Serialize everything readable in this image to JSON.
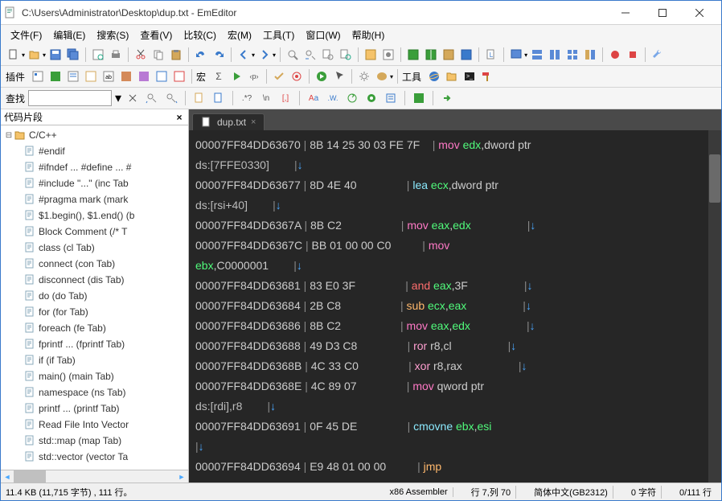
{
  "window": {
    "title": "C:\\Users\\Administrator\\Desktop\\dup.txt - EmEditor"
  },
  "menu": {
    "file": "文件(F)",
    "edit": "编辑(E)",
    "search": "搜索(S)",
    "view": "查看(V)",
    "compare": "比较(C)",
    "macro": "宏(M)",
    "tools": "工具(T)",
    "window": "窗口(W)",
    "help": "帮助(H)"
  },
  "toolbar2": {
    "plugins_label": "插件",
    "macro_label": "宏",
    "tools_label": "工具"
  },
  "findbar": {
    "label": "查找",
    "value": ""
  },
  "sidebar": {
    "title": "代码片段",
    "root": "C/C++",
    "items": [
      "#endif",
      "#ifndef ... #define ... #",
      "#include \"...\"  (inc Tab",
      "#pragma mark  (mark",
      "$1.begin(), $1.end()  (b",
      "Block Comment  (/* T",
      "class  (cl Tab)",
      "connect  (con Tab)",
      "disconnect  (dis Tab)",
      "do  (do Tab)",
      "for  (for Tab)",
      "foreach  (fe Tab)",
      "fprintf ...  (fprintf Tab)",
      "if  (if Tab)",
      "main()  (main Tab)",
      "namespace  (ns Tab)",
      "printf ...  (printf Tab)",
      "Read File Into Vector",
      "std::map  (map Tab)",
      "std::vector  (vector Ta"
    ]
  },
  "tabs": {
    "active": "dup.txt"
  },
  "code": {
    "lines": [
      {
        "addr": "00007FF84DD63670",
        "hex": "8B 14 25 30 03 FE 7F",
        "op": "mov",
        "args": [
          "edx",
          ",dword ptr"
        ]
      },
      {
        "cont": "ds:[7FFE0330]",
        "arrow": "↓"
      },
      {
        "addr": "00007FF84DD63677",
        "hex": "8D 4E 40",
        "op": "lea",
        "args": [
          "ecx",
          ",dword ptr"
        ]
      },
      {
        "cont": "ds:[rsi+40]",
        "arrow": "↓"
      },
      {
        "addr": "00007FF84DD6367A",
        "hex": "8B C2",
        "op": "mov",
        "args": [
          "eax",
          ",",
          "edx"
        ],
        "tail": "↓"
      },
      {
        "addr": "00007FF84DD6367C",
        "hex": "BB 01 00 00 C0",
        "op": "mov",
        "args": []
      },
      {
        "cont": "ebx,C0000001",
        "isreg": true,
        "arrow": "↓"
      },
      {
        "addr": "00007FF84DD63681",
        "hex": "83 E0 3F",
        "op": "and",
        "args": [
          "eax",
          ",3F"
        ],
        "tail": "↓"
      },
      {
        "addr": "00007FF84DD63684",
        "hex": "2B C8",
        "op": "sub",
        "args": [
          "ecx",
          ",",
          "eax"
        ],
        "tail": "↓"
      },
      {
        "addr": "00007FF84DD63686",
        "hex": "8B C2",
        "op": "mov",
        "args": [
          "eax",
          ",",
          "edx"
        ],
        "tail": "↓"
      },
      {
        "addr": "00007FF84DD63688",
        "hex": "49 D3 C8",
        "op": "ror",
        "args": [
          " r8,cl"
        ],
        "tail": "↓"
      },
      {
        "addr": "00007FF84DD6368B",
        "hex": "4C 33 C0",
        "op": "xor",
        "args": [
          " r8,rax"
        ],
        "tail": "↓"
      },
      {
        "addr": "00007FF84DD6368E",
        "hex": "4C 89 07",
        "op": "mov",
        "args": [
          " qword ptr"
        ]
      },
      {
        "cont": "ds:[rdi],r8",
        "arrow": "↓"
      },
      {
        "addr": "00007FF84DD63691",
        "hex": "0F 45 DE",
        "op": "cmovne",
        "args": [
          "ebx",
          ",",
          "esi"
        ]
      },
      {
        "arrow_only": "↓"
      },
      {
        "addr": "00007FF84DD63694",
        "hex": "E9 48 01 00 00",
        "op": "jmp",
        "args": []
      }
    ]
  },
  "status": {
    "left": "11.4 KB (11,715 字节) , 111 行。",
    "lang": "x86 Assembler",
    "pos": "行 7,列 70",
    "enc": "简体中文(GB2312)",
    "chars": "0 字符",
    "lines": "0/111 行"
  }
}
